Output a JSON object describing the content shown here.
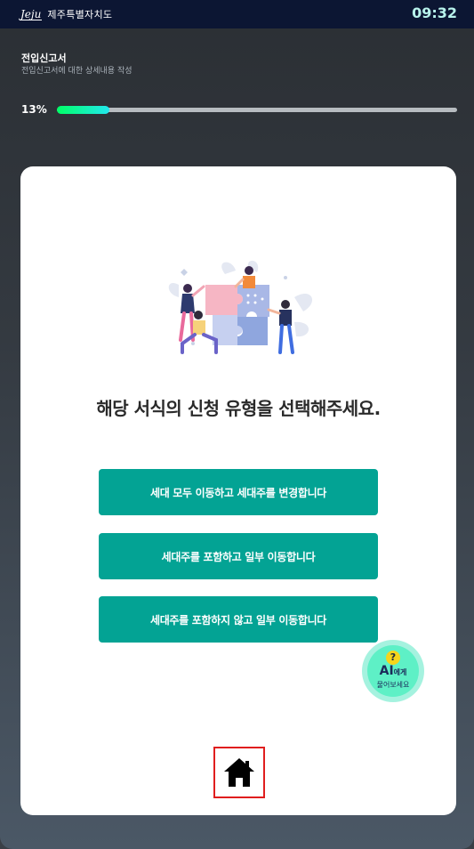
{
  "status_bar": {
    "logo_mark": "Jeju",
    "logo_text": "제주특별자치도",
    "time": "09:32"
  },
  "header": {
    "title": "전입신고서",
    "subtitle": "전입신고서에 대한 상세내용 작성"
  },
  "progress": {
    "label": "13%",
    "value": 0.13
  },
  "main": {
    "illustration": "people-assembling-puzzle-illustration",
    "question": "해당 서식의 신청 유형을 선택해주세요.",
    "options": [
      {
        "label": "세대 모두 이동하고 세대주를 변경합니다"
      },
      {
        "label": "세대주를 포함하고 일부 이동합니다"
      },
      {
        "label": "세대주를 포함하지 않고 일부 이동합니다"
      }
    ]
  },
  "ai_button": {
    "badge": "?",
    "title": "AI",
    "title_suffix": "에게",
    "subtitle": "물어보세요"
  },
  "home_button": {
    "icon": "home-icon"
  },
  "colors": {
    "topbar": "#0c1633",
    "accent": "#03a394",
    "progress_start": "#00ff66",
    "progress_end": "#22e8ee",
    "ai_button": "#5ef0c6",
    "home_highlight": "#e01e1e"
  }
}
